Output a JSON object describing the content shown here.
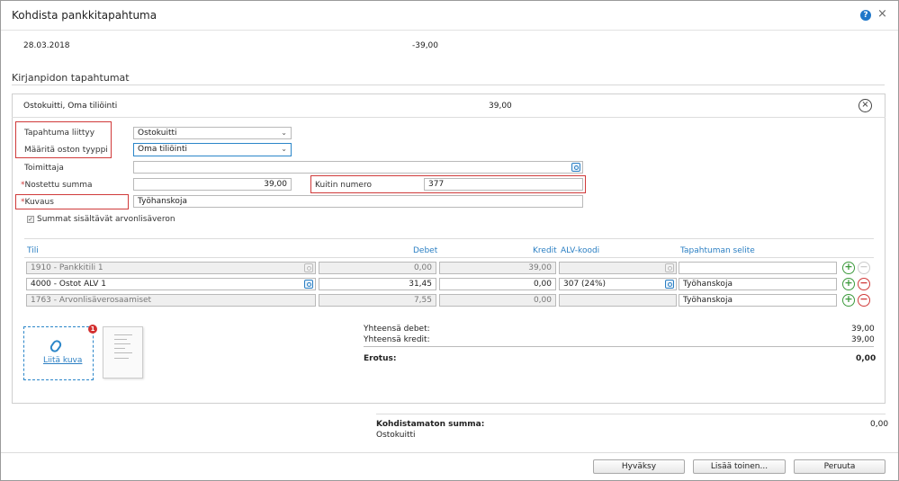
{
  "window": {
    "title": "Kohdista pankkitapahtuma",
    "help": "?",
    "close": "×"
  },
  "transaction": {
    "date": "28.03.2018",
    "amount": "-39,00"
  },
  "section": {
    "title": "Kirjanpidon tapahtumat"
  },
  "entry": {
    "header_label": "Ostokuitti, Oma tiliöinti",
    "header_amount": "39,00",
    "remove_symbol": "×",
    "fields": {
      "tapahtuma_label": "Tapahtuma liittyy",
      "tapahtuma_value": "Ostokuitti",
      "tyyppi_label": "Määritä oston tyyppi",
      "tyyppi_value": "Oma tiliöinti",
      "toimittaja_label": "Toimittaja",
      "toimittaja_value": "",
      "summa_required": "*",
      "summa_label": "Nostettu summa",
      "summa_value": "39,00",
      "kuitti_label": "Kuitin numero",
      "kuitti_value": "377",
      "kuvaus_required": "*",
      "kuvaus_label": "Kuvaus",
      "kuvaus_value": "Työhanskoja",
      "checkbox_label": "Summat sisältävät arvonlisäveron",
      "checkbox_mark": "✓"
    },
    "table": {
      "headers": {
        "tili": "Tili",
        "debet": "Debet",
        "kredit": "Kredit",
        "alv": "ALV-koodi",
        "selite": "Tapahtuman selite"
      },
      "rows": [
        {
          "tili": "1910 - Pankkitili 1",
          "debet": "0,00",
          "kredit": "39,00",
          "alv": "",
          "selite": ""
        },
        {
          "tili": "4000 - Ostot ALV 1",
          "debet": "31,45",
          "kredit": "0,00",
          "alv": "307 (24%)",
          "selite": "Työhanskoja"
        },
        {
          "tili": "1763 - Arvonlisäverosaamiset",
          "debet": "7,55",
          "kredit": "0,00",
          "alv": "",
          "selite": "Työhanskoja"
        }
      ],
      "plus": "+",
      "minus": "−"
    },
    "attachment": {
      "label": "Liitä kuva",
      "badge": "1"
    },
    "totals": {
      "debet_label": "Yhteensä debet:",
      "debet_value": "39,00",
      "kredit_label": "Yhteensä kredit:",
      "kredit_value": "39,00",
      "erotus_label": "Erotus:",
      "erotus_value": "0,00"
    }
  },
  "unallocated": {
    "label": "Kohdistamaton summa:",
    "value": "0,00",
    "sub": "Ostokuitti"
  },
  "buttons": {
    "accept": "Hyväksy",
    "add_another": "Lisää toinen...",
    "cancel": "Peruuta"
  },
  "colors": {
    "accent": "#2b7fc3",
    "error": "#d03a3a",
    "success": "#3c9a3c"
  }
}
